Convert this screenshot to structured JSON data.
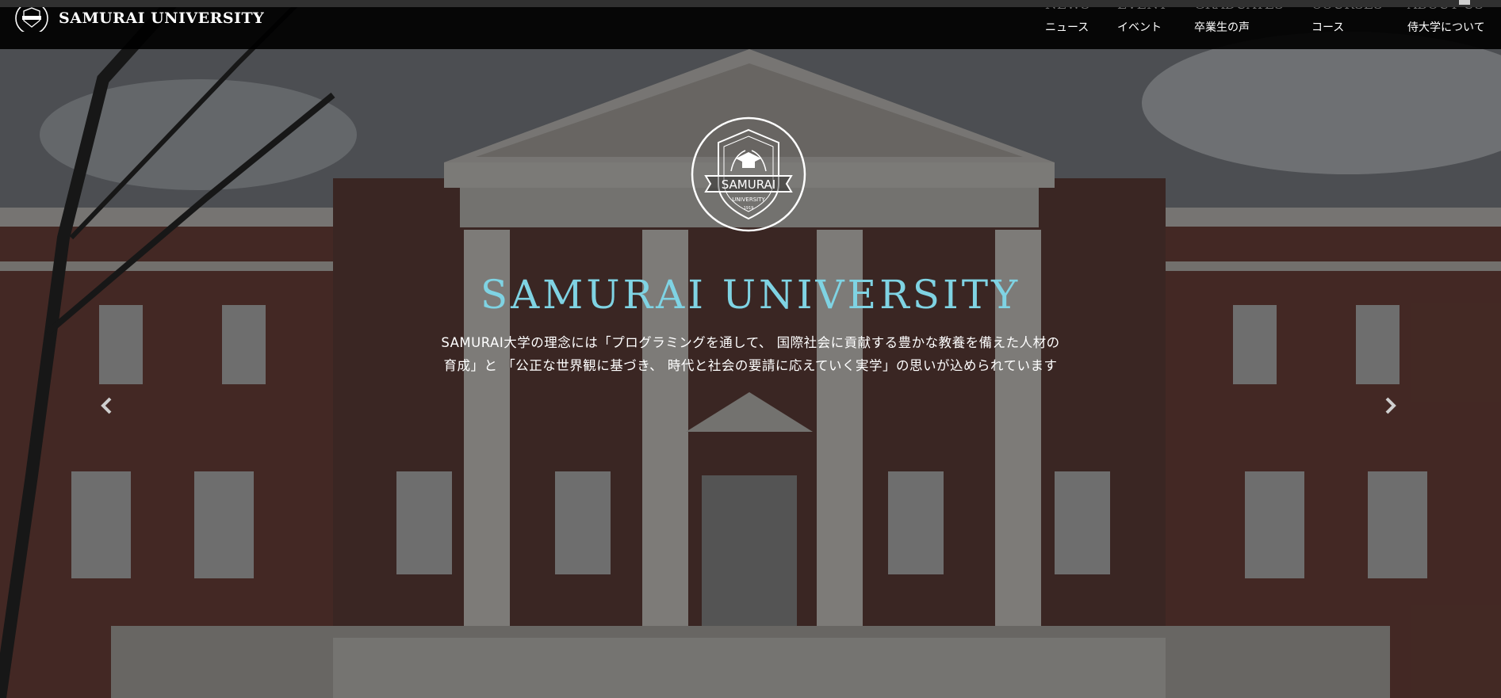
{
  "brand": {
    "name": "SAMURAI UNIVERSITY"
  },
  "nav": [
    {
      "en": "NEWS",
      "jp": "ニュース"
    },
    {
      "en": "EVENT",
      "jp": "イベント"
    },
    {
      "en": "GRADUATES",
      "jp": "卒業生の声"
    },
    {
      "en": "COURSES",
      "jp": "コース"
    },
    {
      "en": "ABOUT US",
      "jp": "侍大学について"
    }
  ],
  "hero": {
    "title": "SAMURAI UNIVERSITY",
    "desc_line1": "SAMURAI大学の理念には「プログラミングを通して、 国際社会に貢献する豊かな教養を備えた人材の",
    "desc_line2": "育成」と 「公正な世界観に基づき、 時代と社会の要請に応えていく実学」の思いが込められています",
    "emblem_text": "SAMURAI",
    "emblem_sub": "UNIVERSITY",
    "emblem_year": "1919"
  },
  "icons": {
    "prev": "chevron-left-icon",
    "next": "chevron-right-icon"
  },
  "colors": {
    "title_accent": "#7fd3e3",
    "navbar_bg": "#000000"
  }
}
